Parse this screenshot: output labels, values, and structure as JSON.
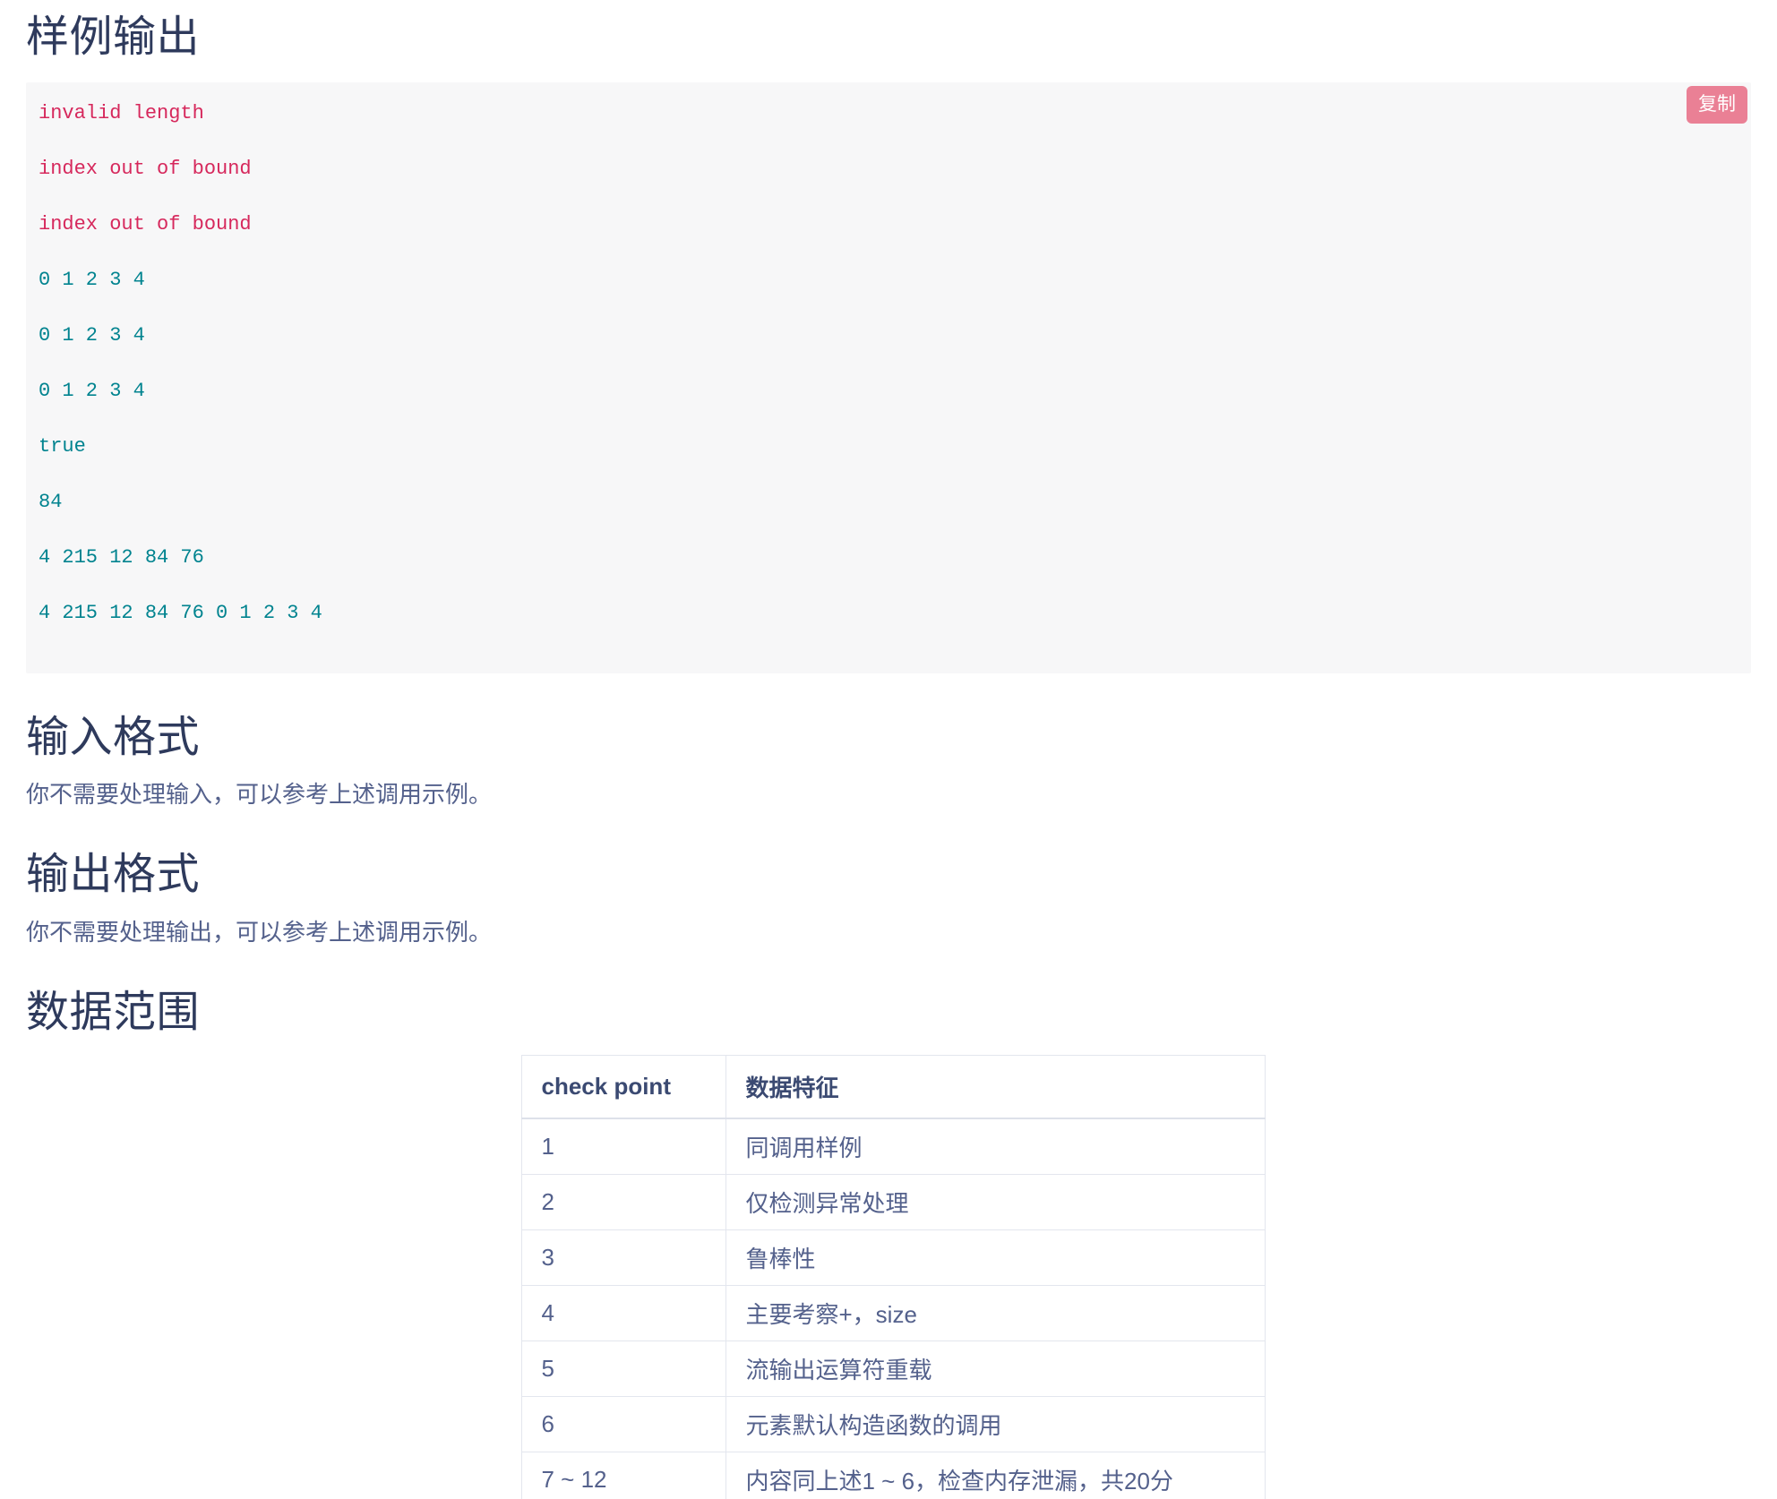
{
  "sections": {
    "sample_output": {
      "heading": "样例输出",
      "copy_label": "复制",
      "code_lines": [
        {
          "text": "invalid length",
          "kind": "error"
        },
        {
          "text": "index out of bound",
          "kind": "error"
        },
        {
          "text": "index out of bound",
          "kind": "error"
        },
        {
          "text": "0 1 2 3 4",
          "kind": "value"
        },
        {
          "text": "0 1 2 3 4",
          "kind": "value"
        },
        {
          "text": "0 1 2 3 4",
          "kind": "value"
        },
        {
          "text": "true",
          "kind": "value"
        },
        {
          "text": "84",
          "kind": "value"
        },
        {
          "text": "4 215 12 84 76",
          "kind": "value"
        },
        {
          "text": "4 215 12 84 76 0 1 2 3 4",
          "kind": "value"
        }
      ]
    },
    "input_format": {
      "heading": "输入格式",
      "body": "你不需要处理输入，可以参考上述调用示例。"
    },
    "output_format": {
      "heading": "输出格式",
      "body": "你不需要处理输出，可以参考上述调用示例。"
    },
    "data_range": {
      "heading": "数据范围",
      "table": {
        "columns": [
          "check point",
          "数据特征"
        ],
        "rows": [
          [
            "1",
            "同调用样例"
          ],
          [
            "2",
            "仅检测异常处理"
          ],
          [
            "3",
            "鲁棒性"
          ],
          [
            "4",
            "主要考察+，size"
          ],
          [
            "5",
            "流输出运算符重载"
          ],
          [
            "6",
            "元素默认构造函数的调用"
          ],
          [
            "7 ~ 12",
            "内容同上述1 ~ 6，检查内存泄漏，共20分"
          ]
        ]
      }
    }
  },
  "colors": {
    "heading": "#2e3a5c",
    "body_text": "#54618c",
    "code_error": "#d6285c",
    "code_value": "#00838f",
    "code_bg": "#f7f7f8",
    "copy_button": "#ea8095",
    "table_border": "#e3e6ee"
  }
}
